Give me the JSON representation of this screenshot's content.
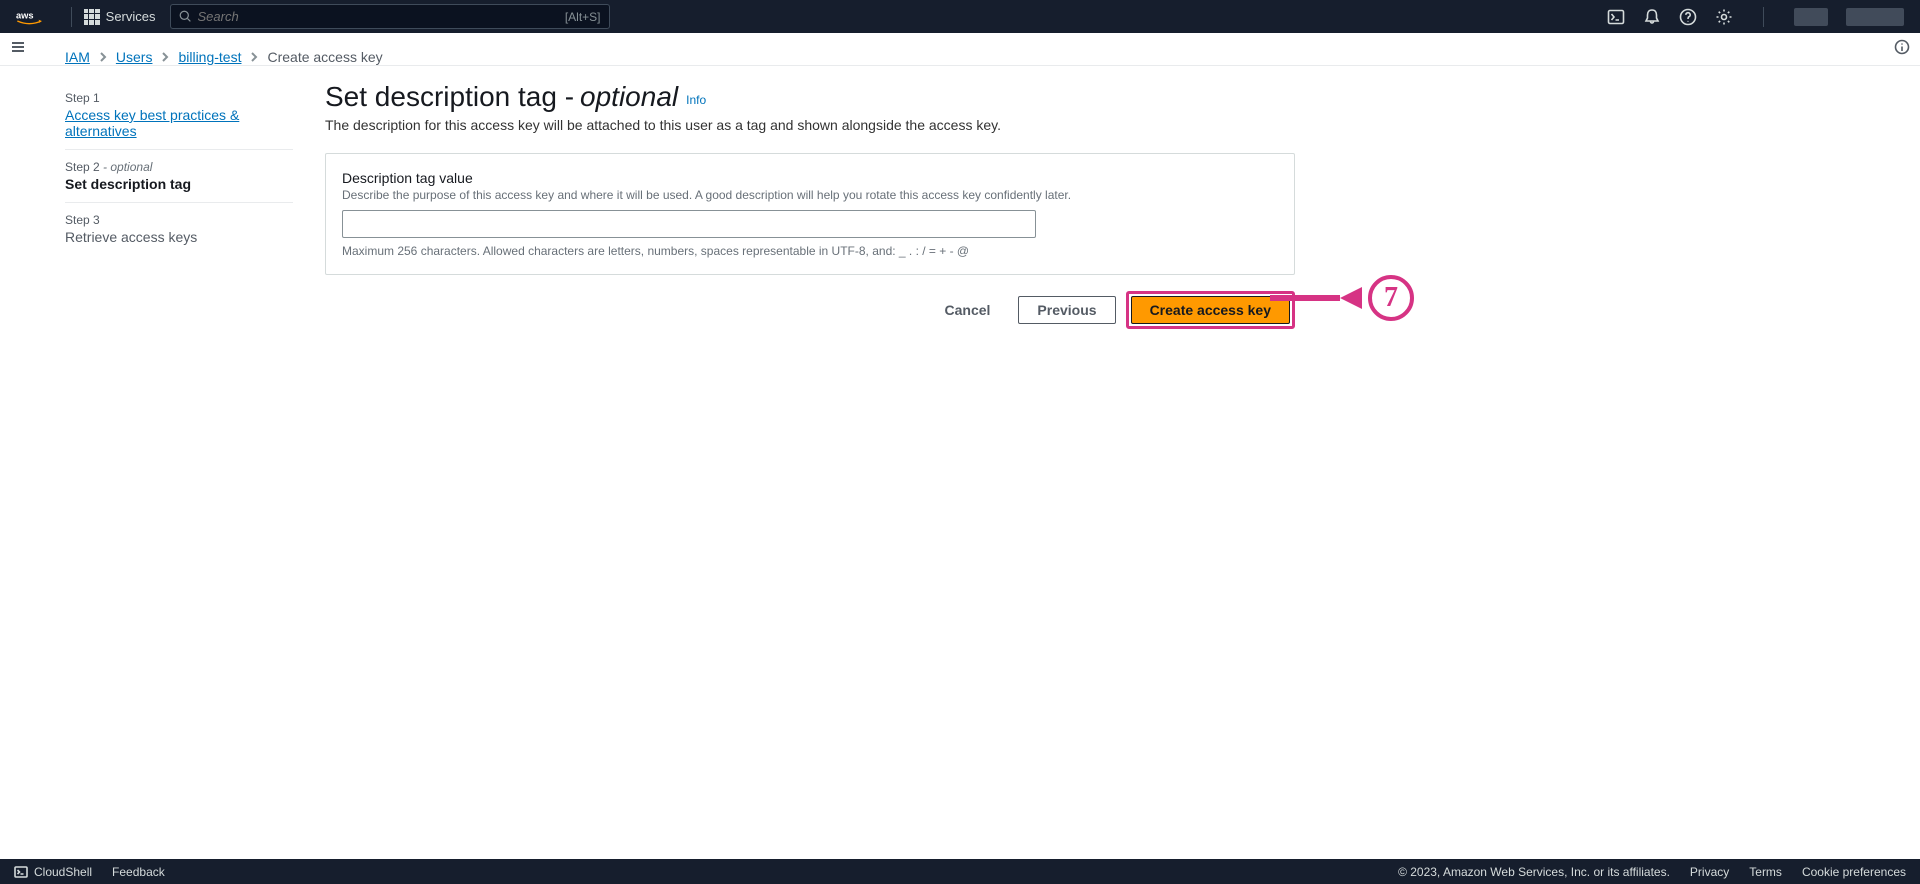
{
  "topnav": {
    "services_label": "Services",
    "search_placeholder": "Search",
    "search_shortcut": "[Alt+S]"
  },
  "breadcrumb": {
    "items": [
      "IAM",
      "Users",
      "billing-test"
    ],
    "current": "Create access key"
  },
  "steps": [
    {
      "num": "Step 1",
      "title": "Access key best practices & alternatives",
      "link": true
    },
    {
      "num": "Step 2",
      "optional": "- optional",
      "title": "Set description tag",
      "current": true
    },
    {
      "num": "Step 3",
      "title": "Retrieve access keys"
    }
  ],
  "page": {
    "title_main": "Set description tag -",
    "title_optional": "optional",
    "info": "Info",
    "description": "The description for this access key will be attached to this user as a tag and shown alongside the access key."
  },
  "form": {
    "label": "Description tag value",
    "help": "Describe the purpose of this access key and where it will be used. A good description will help you rotate this access key confidently later.",
    "value": "",
    "constraint": "Maximum 256 characters. Allowed characters are letters, numbers, spaces representable in UTF-8, and: _ . : / = + - @"
  },
  "actions": {
    "cancel": "Cancel",
    "previous": "Previous",
    "create": "Create access key"
  },
  "annotation": {
    "number": "7"
  },
  "footer": {
    "cloudshell": "CloudShell",
    "feedback": "Feedback",
    "copyright": "© 2023, Amazon Web Services, Inc. or its affiliates.",
    "links": [
      "Privacy",
      "Terms",
      "Cookie preferences"
    ]
  }
}
